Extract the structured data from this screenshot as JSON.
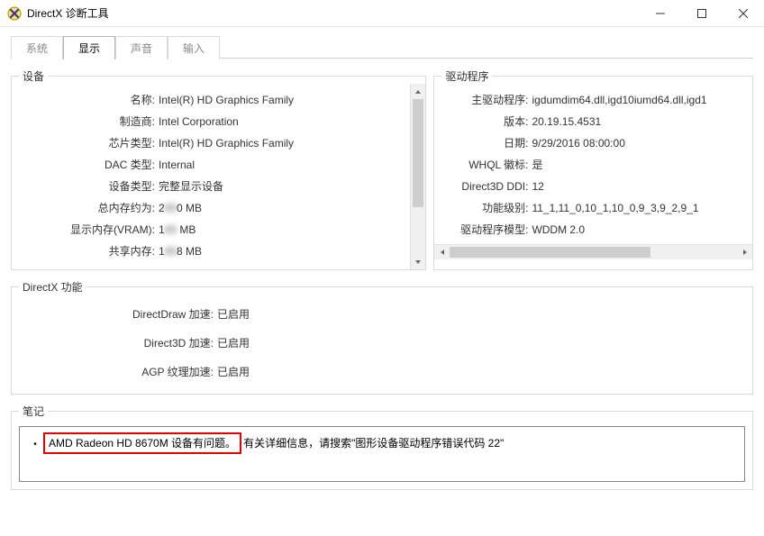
{
  "window": {
    "title": "DirectX 诊断工具"
  },
  "tabs": {
    "system": "系统",
    "display": "显示",
    "sound": "声音",
    "input": "输入"
  },
  "device": {
    "legend": "设备",
    "name_k": "名称:",
    "name_v": "Intel(R) HD Graphics Family",
    "manu_k": "制造商:",
    "manu_v": "Intel Corporation",
    "chip_k": "芯片类型:",
    "chip_v": "Intel(R) HD Graphics Family",
    "dac_k": "DAC 类型:",
    "dac_v": "Internal",
    "devtype_k": "设备类型:",
    "devtype_v": "完整显示设备",
    "totmem_k": "总内存约为:",
    "totmem_v": "2   0 MB",
    "vram_k": "显示内存(VRAM):",
    "vram_v": "1     MB",
    "shared_k": "共享内存:",
    "shared_v": "1   8 MB"
  },
  "driver": {
    "legend": "驱动程序",
    "main_k": "主驱动程序:",
    "main_v": "igdumdim64.dll,igd10iumd64.dll,igd1",
    "ver_k": "版本:",
    "ver_v": "20.19.15.4531",
    "date_k": "日期:",
    "date_v": "9/29/2016 08:00:00",
    "whql_k": "WHQL 徽标:",
    "whql_v": "是",
    "ddi_k": "Direct3D DDI:",
    "ddi_v": "12",
    "feat_k": "功能级别:",
    "feat_v": "11_1,11_0,10_1,10_0,9_3,9_2,9_1",
    "model_k": "驱动程序模型:",
    "model_v": "WDDM 2.0"
  },
  "dxfeat": {
    "legend": "DirectX 功能",
    "dd_k": "DirectDraw 加速:",
    "dd_v": "已启用",
    "d3d_k": "Direct3D 加速:",
    "d3d_v": "已启用",
    "agp_k": "AGP 纹理加速:",
    "agp_v": "已启用"
  },
  "notes": {
    "legend": "笔记",
    "highlight": "AMD Radeon HD 8670M 设备有问题。",
    "tail": "有关详细信息，请搜索\"图形设备驱动程序错误代码 22\""
  }
}
